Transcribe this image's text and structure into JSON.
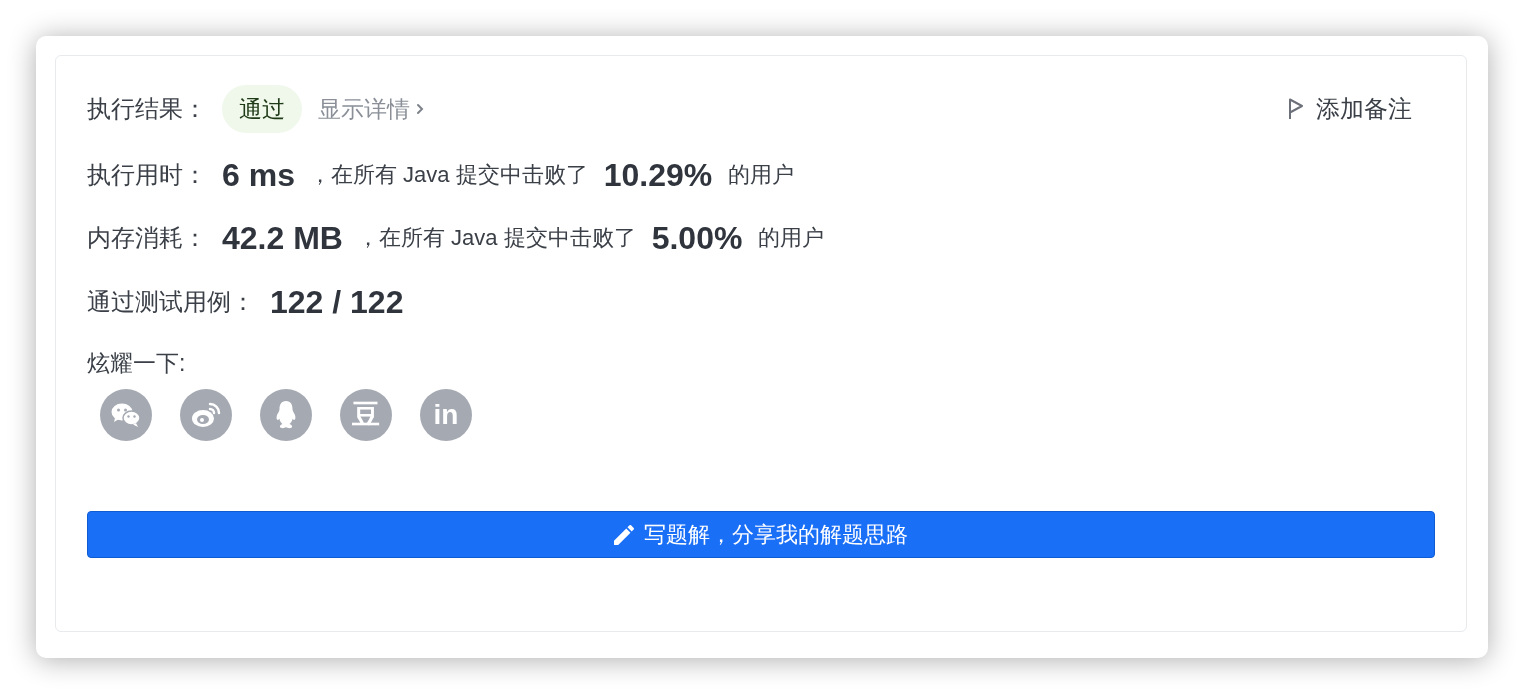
{
  "result": {
    "label": "执行结果：",
    "status": {
      "text": "通过",
      "kind": "accepted"
    },
    "details_link": "显示详情"
  },
  "add_note": "添加备注",
  "stats": [
    {
      "label": "执行用时：",
      "value": "6 ms",
      "beat_text": "，在所有 Java 提交中击败了",
      "percent": "10.29%",
      "suffix": "的用户"
    },
    {
      "label": "内存消耗：",
      "value": "42.2 MB",
      "beat_text": "，在所有 Java 提交中击败了",
      "percent": "5.00%",
      "suffix": "的用户"
    }
  ],
  "test_cases": {
    "label": "通过测试用例：",
    "value": "122 / 122"
  },
  "share": {
    "label": "炫耀一下:",
    "targets": [
      {
        "kind": "chat"
      },
      {
        "kind": "swirl"
      },
      {
        "kind": "penguin"
      },
      {
        "kind": "glyph",
        "text": "豆"
      },
      {
        "kind": "glyph",
        "text": "in"
      }
    ]
  },
  "write_solution_button": "写题解，分享我的解题思路"
}
